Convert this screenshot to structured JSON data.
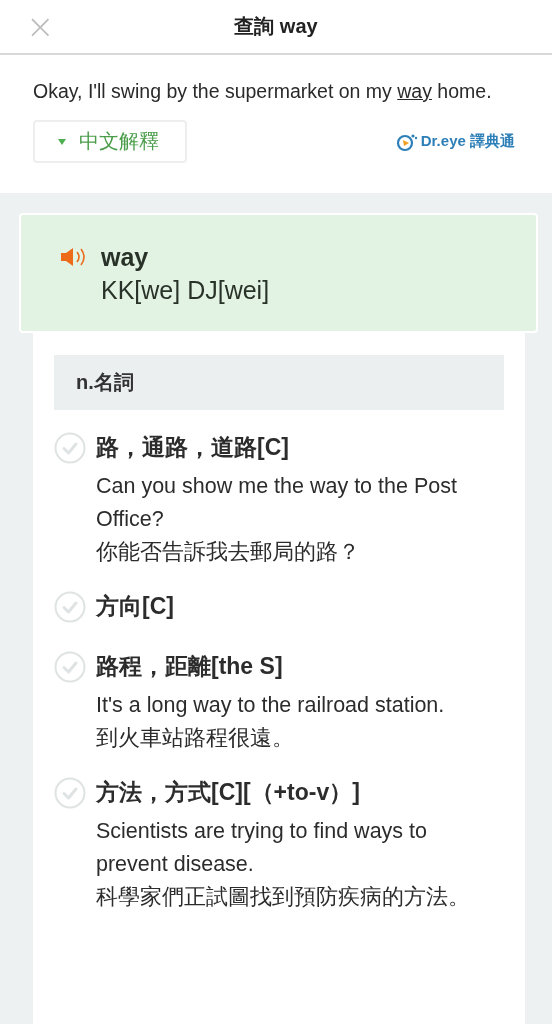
{
  "header": {
    "close_icon": "×",
    "title": "查詢 way"
  },
  "sentence": {
    "before": "Okay, I'll swing by the supermarket on my ",
    "word": "way",
    "after": " home."
  },
  "toggle": {
    "label": "中文解釋",
    "expanded": true
  },
  "brand": {
    "label": "Dr.eye 譯典通"
  },
  "entry": {
    "word": "way",
    "phonetic": "KK[we] DJ[wei]"
  },
  "part_of_speech": "n.名詞",
  "definitions": [
    {
      "text": "路，通路，道路[C]",
      "checked": false,
      "example_en": "Can you show me the way to the Post Office?",
      "example_zh": "你能否告訴我去郵局的路？"
    },
    {
      "text": "方向[C]",
      "checked": false
    },
    {
      "text": "路程，距離[the S]",
      "checked": false,
      "example_en": "It's a long way to the railroad station.",
      "example_zh": "到火車站路程很遠。"
    },
    {
      "text": "方法，方式[C][（+to-v）]",
      "checked": false,
      "example_en": "Scientists are trying to find ways to prevent disease.",
      "example_zh": "科學家們正試圖找到預防疾病的方法。"
    }
  ]
}
